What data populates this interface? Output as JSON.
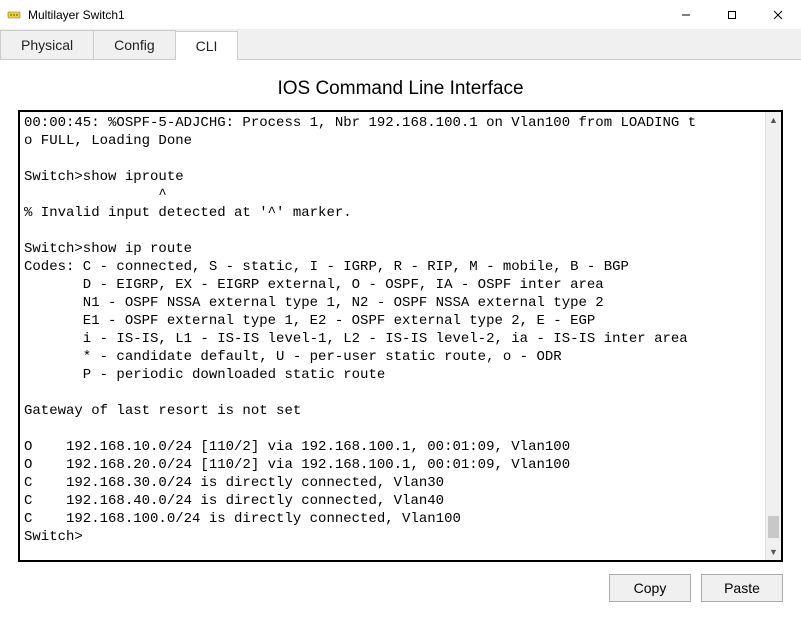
{
  "window": {
    "title": "Multilayer Switch1"
  },
  "tabs": {
    "physical": "Physical",
    "config": "Config",
    "cli": "CLI"
  },
  "cli": {
    "heading": "IOS Command Line Interface",
    "lines": [
      "00:00:45: %OSPF-5-ADJCHG: Process 1, Nbr 192.168.100.1 on Vlan100 from LOADING t",
      "o FULL, Loading Done",
      "",
      "Switch>show iproute",
      "                ^",
      "% Invalid input detected at '^' marker.",
      "\t",
      "Switch>show ip route",
      "Codes: C - connected, S - static, I - IGRP, R - RIP, M - mobile, B - BGP",
      "       D - EIGRP, EX - EIGRP external, O - OSPF, IA - OSPF inter area",
      "       N1 - OSPF NSSA external type 1, N2 - OSPF NSSA external type 2",
      "       E1 - OSPF external type 1, E2 - OSPF external type 2, E - EGP",
      "       i - IS-IS, L1 - IS-IS level-1, L2 - IS-IS level-2, ia - IS-IS inter area",
      "       * - candidate default, U - per-user static route, o - ODR",
      "       P - periodic downloaded static route",
      "",
      "Gateway of last resort is not set",
      "",
      "O    192.168.10.0/24 [110/2] via 192.168.100.1, 00:01:09, Vlan100",
      "O    192.168.20.0/24 [110/2] via 192.168.100.1, 00:01:09, Vlan100",
      "C    192.168.30.0/24 is directly connected, Vlan30",
      "C    192.168.40.0/24 is directly connected, Vlan40",
      "C    192.168.100.0/24 is directly connected, Vlan100",
      "Switch>"
    ]
  },
  "buttons": {
    "copy": "Copy",
    "paste": "Paste"
  }
}
